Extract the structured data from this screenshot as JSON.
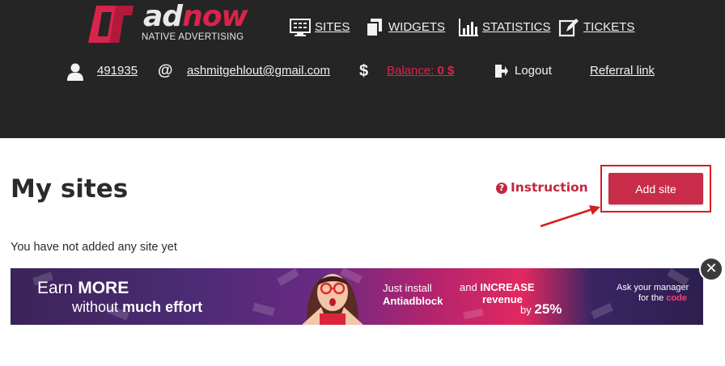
{
  "brand": {
    "logo_word_a": "ad",
    "logo_word_b": "now",
    "tagline": "NATIVE ADVERTISING"
  },
  "nav": {
    "items": [
      {
        "label": "SITES",
        "icon": "monitor-icon"
      },
      {
        "label": "WIDGETS",
        "icon": "layers-icon"
      },
      {
        "label": "STATISTICS",
        "icon": "bar-chart-icon"
      },
      {
        "label": "TICKETS",
        "icon": "edit-icon"
      }
    ]
  },
  "user": {
    "id": "491935",
    "at_symbol": "@",
    "email": "ashmitgehlout@gmail.com",
    "currency_symbol": "$",
    "balance_label": "Balance:",
    "balance_value": "0 $",
    "logout": "Logout",
    "referral": "Referral link"
  },
  "main": {
    "title": "My sites",
    "instruction": "Instruction",
    "add_site": "Add site",
    "empty_message": "You have not added any site yet"
  },
  "banner": {
    "earn": "Earn",
    "more": "MORE",
    "without": "without",
    "much_effort": "much effort",
    "just_install": "Just install",
    "antiadblock": "Antiadblock",
    "and_increase_a": "and",
    "and_increase_b": "INCREASE",
    "revenue": "revenue",
    "by": "by",
    "pct": "25%",
    "ask_manager": "Ask your manager",
    "for_the": "for the",
    "code": "code"
  },
  "close_glyph": "✕",
  "colors": {
    "accent": "#c82c49",
    "header_bg": "#252525",
    "annotation": "#d81d1d"
  }
}
